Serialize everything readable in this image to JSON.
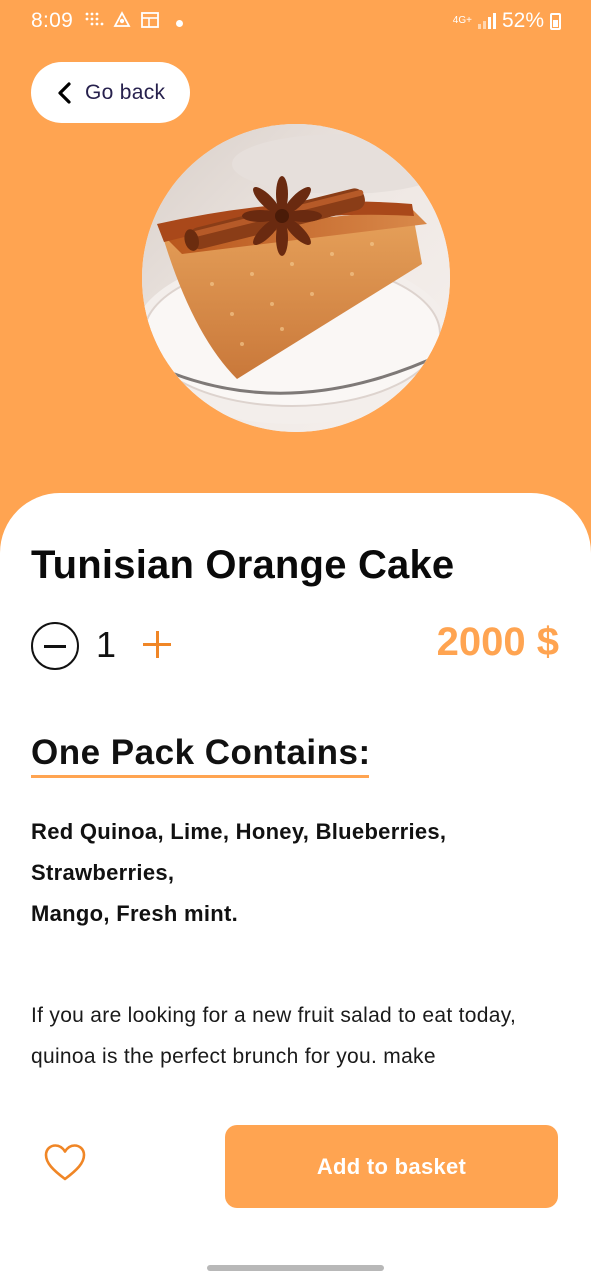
{
  "status_bar": {
    "time": "8:09",
    "network": "4G+",
    "battery_percent": "52%"
  },
  "nav": {
    "back_label": "Go back"
  },
  "product": {
    "image_alt": "Tunisian orange cake slice with cinnamon stick and star anise",
    "title": "Tunisian Orange Cake",
    "quantity": "1",
    "price": "2000 $"
  },
  "pack": {
    "heading": "One Pack Contains:",
    "ingredients_lines": [
      "Red Quinoa, Lime, Honey, Blueberries,",
      "Strawberries,",
      "Mango, Fresh mint."
    ]
  },
  "description": {
    "lines": [
      "If you are looking for a new fruit salad to eat today,",
      "quinoa is the perfect brunch for you. make"
    ]
  },
  "actions": {
    "add_to_basket_label": "Add to basket"
  },
  "colors": {
    "accent": "#FFA451",
    "plus_icon": "#F08626",
    "text_dark": "#111111",
    "back_text": "#27214D"
  },
  "icons": {
    "back": "chevron-left-icon",
    "minus": "minus-circle-icon",
    "plus": "plus-icon",
    "favorite": "heart-outline-icon"
  }
}
